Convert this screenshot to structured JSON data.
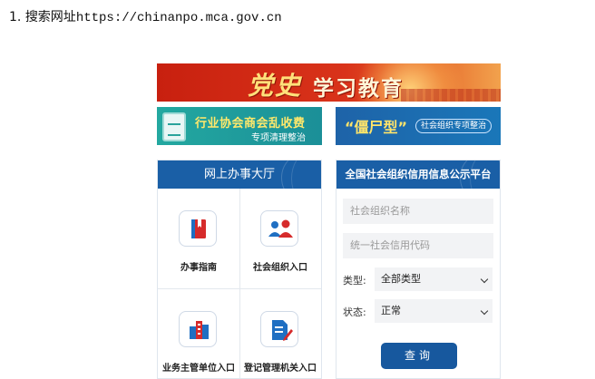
{
  "instruction": {
    "step_number": "1.",
    "text": "搜索网址",
    "url": "https://chinanpo.mca.gov.cn"
  },
  "banners": {
    "top": {
      "party_text": "党史",
      "study_text": "学习教育"
    },
    "left": {
      "line1": "行业协会商会乱收费",
      "line2": "专项清理整治"
    },
    "right": {
      "zombie_text": "“僵尸型”",
      "pill_text": "社会组织专项整治"
    }
  },
  "left_panel": {
    "title": "网上办事大厅",
    "items": [
      {
        "label": "办事指南",
        "icon": "book-icon"
      },
      {
        "label": "社会组织入口",
        "icon": "users-icon"
      },
      {
        "label": "业务主管单位入口",
        "icon": "buildings-icon"
      },
      {
        "label": "登记管理机关入口",
        "icon": "edit-document-icon"
      }
    ]
  },
  "right_panel": {
    "title": "全国社会组织信用信息公示平台",
    "name_placeholder": "社会组织名称",
    "code_placeholder": "统一社会信用代码",
    "type_label": "类型:",
    "type_value": "全部类型",
    "status_label": "状态:",
    "status_value": "正常",
    "query_label": "查询"
  },
  "colors": {
    "header_blue": "#1a5fa6",
    "button_blue": "#17589e",
    "icon_red": "#d62b2b",
    "icon_blue": "#1f6fc2"
  }
}
